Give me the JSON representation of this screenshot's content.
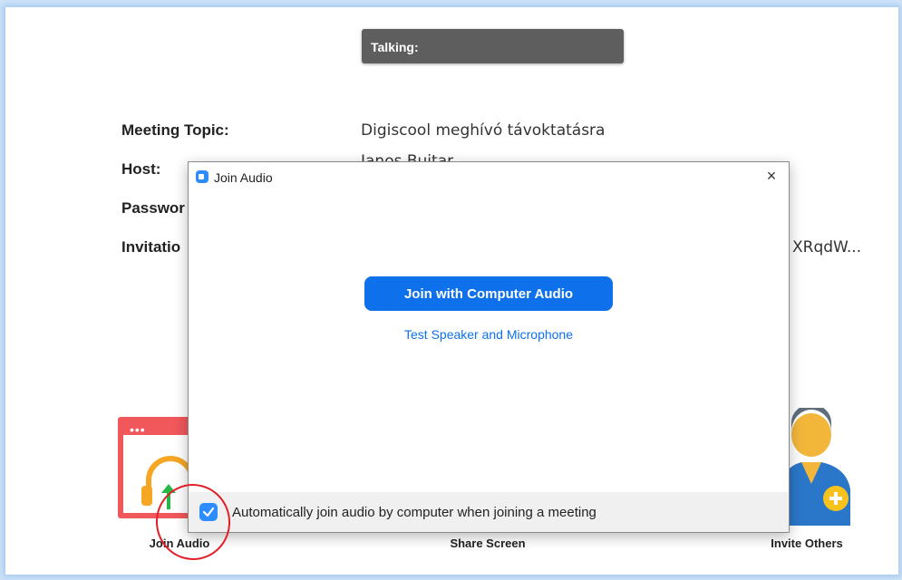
{
  "talking": {
    "label": "Talking:"
  },
  "meeting": {
    "topic_label": "Meeting Topic:",
    "topic_value": "Digiscool meghívó távoktatásra",
    "host_label": "Host:",
    "host_value": "Janos Buitar",
    "password_label": "Passwor",
    "invitation_label": "Invitatio",
    "invitation_value": "XRqdW..."
  },
  "tiles": {
    "join_audio": "Join Audio",
    "share_screen": "Share Screen",
    "invite_others": "Invite Others"
  },
  "dialog": {
    "title": "Join Audio",
    "close": "×",
    "primary_button": "Join with Computer Audio",
    "test_link": "Test Speaker and Microphone",
    "auto_join_label": "Automatically join audio by computer when joining a meeting",
    "auto_join_checked": true
  },
  "colors": {
    "primary": "#0e71eb",
    "annotation": "#e2202a"
  }
}
